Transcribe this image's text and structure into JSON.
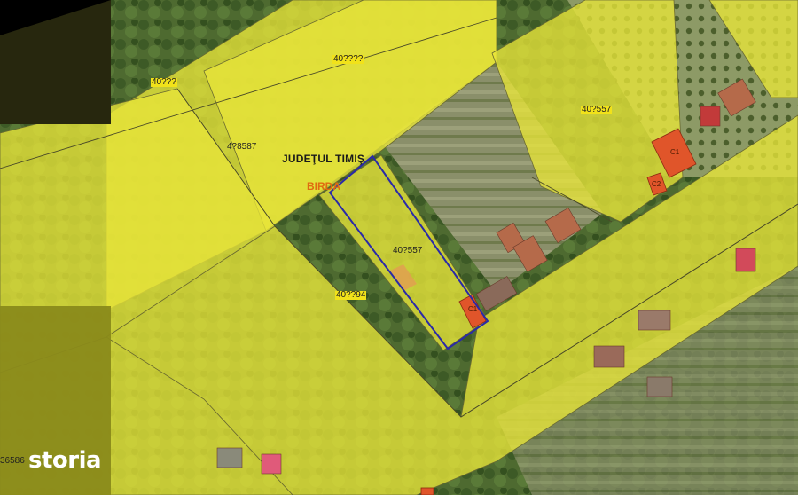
{
  "map": {
    "county_label": "JUDEŢUL TIMIŞ",
    "town_label": "BIRDA",
    "parcels": [
      {
        "id": "top_left_strip",
        "label": "40???"
      },
      {
        "id": "top_mid",
        "label": "40????"
      },
      {
        "id": "left_big",
        "label": "4?8587"
      },
      {
        "id": "right_top",
        "label": "40?557"
      },
      {
        "id": "selected",
        "label": "40?557"
      },
      {
        "id": "road_mid",
        "label": "40??94"
      },
      {
        "id": "bottom_left_edge",
        "label": "36586"
      }
    ],
    "buildings": [
      {
        "id": "c1_right",
        "label": "C1"
      },
      {
        "id": "c2_right",
        "label": "C2"
      },
      {
        "id": "c1_selected",
        "label": "C1"
      }
    ],
    "colors": {
      "parcel_fill": "#e8e63a",
      "selection_outline": "#2a2aa8",
      "building_fill": "#e0552a"
    }
  },
  "watermark": {
    "brand": "storia"
  }
}
